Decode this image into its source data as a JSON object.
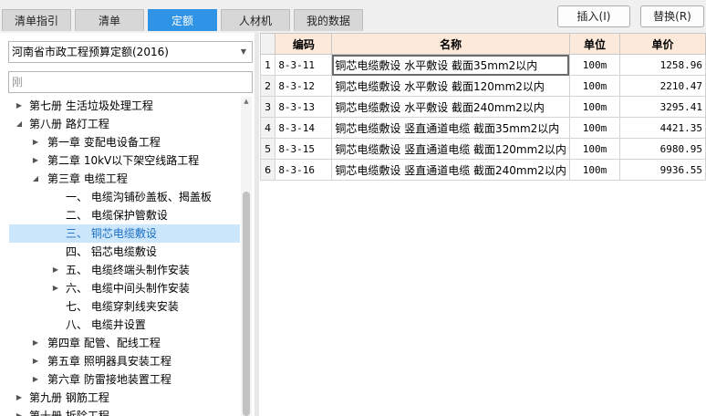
{
  "tabs": [
    {
      "label": "清单指引"
    },
    {
      "label": "清单"
    },
    {
      "label": "定额"
    },
    {
      "label": "人材机"
    },
    {
      "label": "我的数据"
    }
  ],
  "toolbar": {
    "insert_label": "插入(I)",
    "replace_label": "替换(R)"
  },
  "quota_lib": {
    "selected": "河南省市政工程预算定额(2016)"
  },
  "search": {
    "value": "",
    "placeholder": "刚"
  },
  "tree": [
    {
      "label": "第七册 生活垃圾处理工程"
    },
    {
      "label": "第八册 路灯工程"
    },
    {
      "label": "第一章 变配电设备工程"
    },
    {
      "label": "第二章 10kV以下架空线路工程"
    },
    {
      "label": "第三章 电缆工程"
    },
    {
      "label": "一、 电缆沟铺砂盖板、揭盖板"
    },
    {
      "label": "二、 电缆保护管敷设"
    },
    {
      "label": "三、 铜芯电缆敷设"
    },
    {
      "label": "四、 铝芯电缆敷设"
    },
    {
      "label": "五、 电缆终端头制作安装"
    },
    {
      "label": "六、 电缆中间头制作安装"
    },
    {
      "label": "七、 电缆穿刺线夹安装"
    },
    {
      "label": "八、 电缆井设置"
    },
    {
      "label": "第四章 配管、配线工程"
    },
    {
      "label": "第五章 照明器具安装工程"
    },
    {
      "label": "第六章 防雷接地装置工程"
    },
    {
      "label": "第九册 钢筋工程"
    },
    {
      "label": "第十册 拆除工程"
    }
  ],
  "grid": {
    "columns": [
      "编码",
      "名称",
      "单位",
      "单价"
    ],
    "rows": [
      {
        "num": "1",
        "code": "8-3-11",
        "name": "铜芯电缆敷设 水平敷设 截面35mm2以内",
        "unit": "100m",
        "price": "1258.96"
      },
      {
        "num": "2",
        "code": "8-3-12",
        "name": "铜芯电缆敷设 水平敷设 截面120mm2以内",
        "unit": "100m",
        "price": "2210.47"
      },
      {
        "num": "3",
        "code": "8-3-13",
        "name": "铜芯电缆敷设 水平敷设 截面240mm2以内",
        "unit": "100m",
        "price": "3295.41"
      },
      {
        "num": "4",
        "code": "8-3-14",
        "name": "铜芯电缆敷设 竖直通道电缆 截面35mm2以内",
        "unit": "100m",
        "price": "4421.35"
      },
      {
        "num": "5",
        "code": "8-3-15",
        "name": "铜芯电缆敷设 竖直通道电缆 截面120mm2以内",
        "unit": "100m",
        "price": "6980.95"
      },
      {
        "num": "6",
        "code": "8-3-16",
        "name": "铜芯电缆敷设 竖直通道电缆 截面240mm2以内",
        "unit": "100m",
        "price": "9936.55"
      }
    ]
  },
  "colors": {
    "accent": "#2f93e6",
    "header_bg": "#fde9d9",
    "selection_bg": "#cce6fb"
  }
}
